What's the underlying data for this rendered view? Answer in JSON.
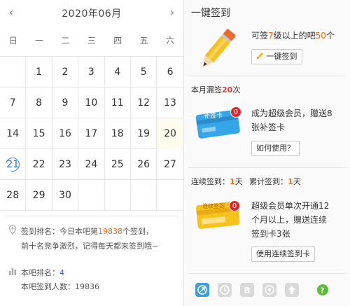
{
  "calendar": {
    "title": "2020年06月",
    "prev": "‹",
    "next": "›",
    "weekdays": [
      "日",
      "一",
      "二",
      "三",
      "四",
      "五",
      "六"
    ],
    "rows": [
      [
        "",
        "1",
        "2",
        "3",
        "4",
        "5",
        "6"
      ],
      [
        "7",
        "8",
        "9",
        "10",
        "11",
        "12",
        "13"
      ],
      [
        "14",
        "15",
        "16",
        "17",
        "18",
        "19",
        "20"
      ],
      [
        "21",
        "22",
        "23",
        "24",
        "25",
        "26",
        "27"
      ],
      [
        "28",
        "29",
        "30",
        "",
        "",
        "",
        ""
      ]
    ],
    "today": "21",
    "highlight": "20"
  },
  "rank": {
    "line1_prefix": "签到排名：今日本吧第",
    "line1_num": "19838",
    "line1_suffix": "个签到，",
    "line2": "前十名竞争激烈，记得每天都来签到哦~",
    "bar_rank_label": "本吧排名：",
    "bar_rank_value": "4",
    "bar_count": "本吧签到人数：19836"
  },
  "panel": {
    "title": "一键签到",
    "onekey_text_1": "可签",
    "onekey_level": "7",
    "onekey_text_2": "级以上的吧",
    "onekey_count": "50",
    "onekey_text_3": "个",
    "onekey_button": "一键签到",
    "missed_label": "本月漏签",
    "missed_count": "20",
    "missed_unit": "次",
    "vip_text_1": "成为超级会员，赠送8",
    "vip_text_2": "张补签卡",
    "vip_button": "如何使用？",
    "card_badge": "0",
    "streak_label": "连续签到：",
    "streak_value": "1",
    "streak_unit": "天",
    "total_label": "累计签到：",
    "total_value": "1",
    "total_unit": "天",
    "super_text_1": "超级会员单次开通12",
    "super_text_2": "个月以上，赠送连续",
    "super_text_3": "签到卡3张",
    "super_button": "使用连续签到卡",
    "card_label_1": "补签卡",
    "card_label_2": "连续签到"
  },
  "colors": {
    "accent_orange": "#f36b1c",
    "accent_red": "#e4393c",
    "accent_blue": "#2a6fd6",
    "card_blue": "#35a6e8",
    "card_yellow": "#f6c21c"
  },
  "toolbar_icons": [
    "share-icon",
    "sync-icon",
    "b-icon",
    "location-icon",
    "up-icon",
    "help-icon"
  ]
}
